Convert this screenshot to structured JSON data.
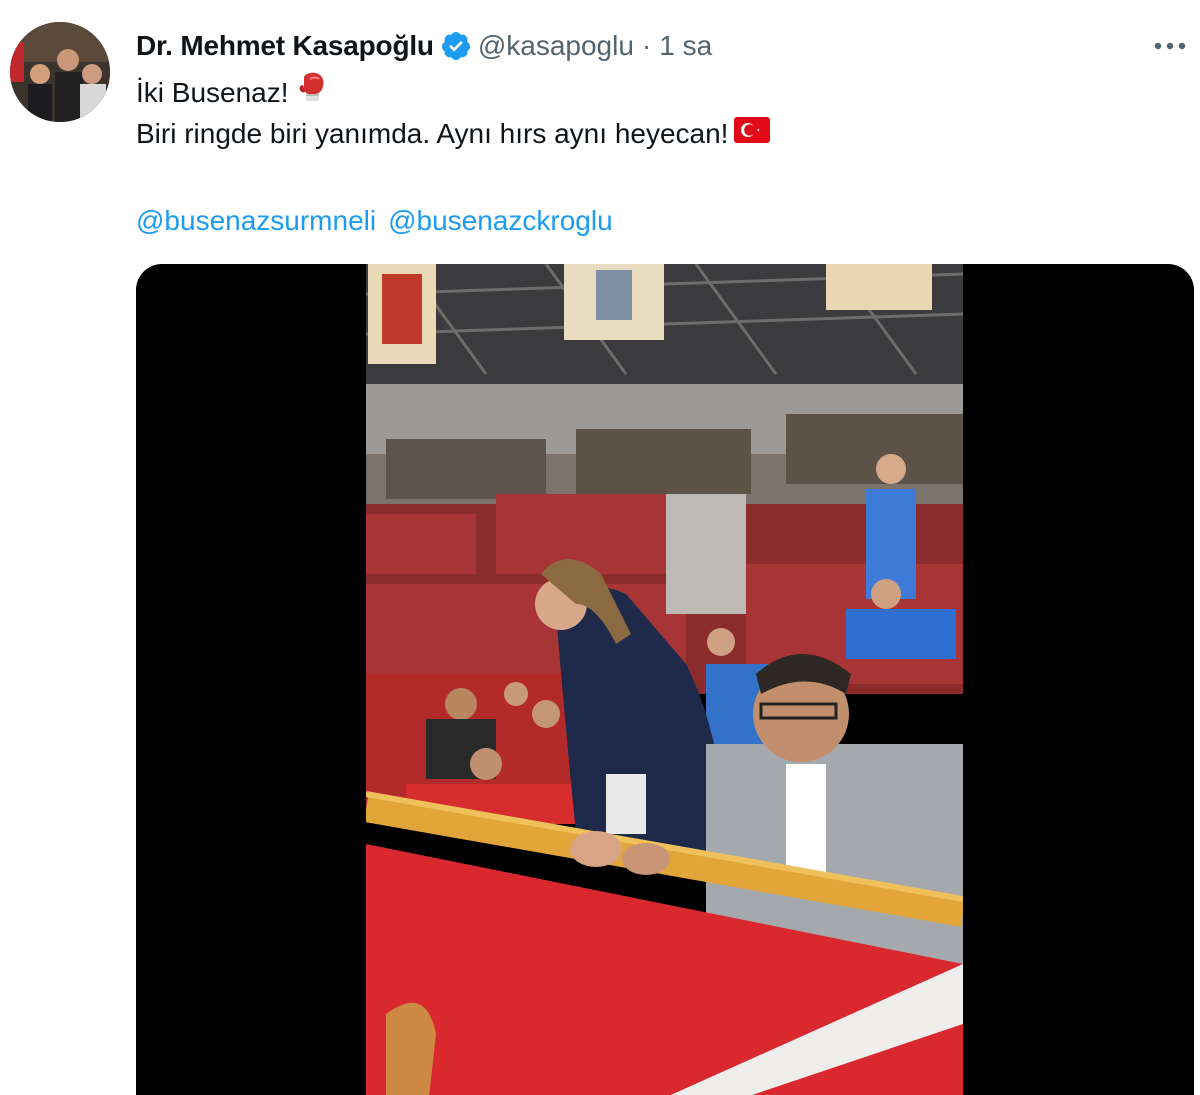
{
  "author": {
    "name": "Dr. Mehmet Kasapoğlu",
    "handle": "@kasapoglu",
    "separator": "·",
    "time": "1 sa",
    "verified": true,
    "avatar_icon": "profile-photo"
  },
  "tweet": {
    "line1": "İki Busenaz!",
    "line1_emoji": "boxing-glove-icon",
    "line2": "Biri ringde biri yanımda. Aynı hırs aynı heyecan!",
    "line2_emoji": "turkey-flag-icon",
    "mentions": [
      "@busenazsurmneli",
      "@busenazckroglu"
    ]
  },
  "media": {
    "type": "video"
  },
  "colors": {
    "link": "#1d9bf0",
    "verified": "#1d9bf0",
    "secondary_text": "#536471",
    "primary_text": "#0f1419",
    "media_bg": "#000000"
  }
}
